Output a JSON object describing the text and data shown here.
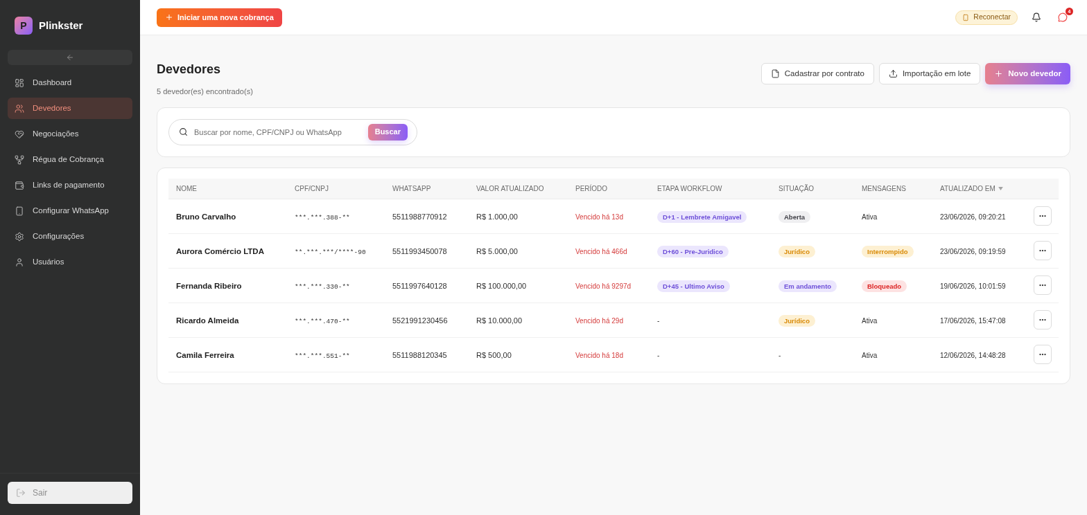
{
  "sidebar": {
    "brand": {
      "initial": "P",
      "name": "Plinkster"
    },
    "items": [
      {
        "label": "Dashboard",
        "selected": false
      },
      {
        "label": "Devedores",
        "selected": true
      },
      {
        "label": "Negociações",
        "selected": false
      },
      {
        "label": "Régua de Cobrança",
        "selected": false
      },
      {
        "label": "Links de pagamento",
        "selected": false
      },
      {
        "label": "Configurar WhatsApp",
        "selected": false
      },
      {
        "label": "Configurações",
        "selected": false
      },
      {
        "label": "Usuários",
        "selected": false
      }
    ],
    "logout": "Sair"
  },
  "topbar": {
    "primary_action": "Iniciar uma nova cobrança",
    "reconnect": "Reconectar",
    "message_count": "4"
  },
  "page": {
    "title": "Devedores",
    "subtitle": "5 devedor(es) encontrado(s)",
    "actions": [
      {
        "label": "Cadastrar por contrato",
        "kind": "outline"
      },
      {
        "label": "Importação em lote",
        "kind": "outline"
      },
      {
        "label": "Novo devedor",
        "kind": "primary"
      }
    ]
  },
  "search": {
    "placeholder": "Buscar por nome, CPF/CNPJ ou WhatsApp",
    "button": "Buscar"
  },
  "table": {
    "columns": [
      {
        "label": "NOME",
        "sorted": false
      },
      {
        "label": "CPF/CNPJ",
        "sorted": false
      },
      {
        "label": "WHATSAPP",
        "sorted": false
      },
      {
        "label": "VALOR ATUALIZADO",
        "sorted": false
      },
      {
        "label": "PERÍODO",
        "sorted": false
      },
      {
        "label": "ETAPA WORKFLOW",
        "sorted": false
      },
      {
        "label": "SITUAÇÃO",
        "sorted": false
      },
      {
        "label": "MENSAGENS",
        "sorted": false
      },
      {
        "label": "ATUALIZADO EM",
        "sorted": true
      }
    ],
    "rows": [
      {
        "nome": "Bruno Carvalho",
        "cpf_cnpj": "***.***.388-**",
        "whatsapp": "5511988770912",
        "valor": "R$ 1.000,00",
        "periodo": "Vencido há 13d",
        "etapa": {
          "text": "D+1 - Lembrete Amigavel",
          "kind": "info"
        },
        "situacao": {
          "text": "Aberta",
          "kind": "neutral"
        },
        "mensagens": {
          "text": "Ativa",
          "kind": "plain"
        },
        "atualizado": "23/06/2026, 09:20:21"
      },
      {
        "nome": "Aurora Comércio LTDA",
        "cpf_cnpj": "**.***.***/****-90",
        "whatsapp": "5511993450078",
        "valor": "R$ 5.000,00",
        "periodo": "Vencido há 466d",
        "etapa": {
          "text": "D+60 - Pre-Juridico",
          "kind": "info"
        },
        "situacao": {
          "text": "Jurídico",
          "kind": "warning"
        },
        "mensagens": {
          "text": "Interrompido",
          "kind": "warning"
        },
        "atualizado": "23/06/2026, 09:19:59"
      },
      {
        "nome": "Fernanda Ribeiro",
        "cpf_cnpj": "***.***.330-**",
        "whatsapp": "5511997640128",
        "valor": "R$ 100.000,00",
        "periodo": "Vencido há 9297d",
        "etapa": {
          "text": "D+45 - Ultimo Aviso",
          "kind": "info"
        },
        "situacao": {
          "text": "Em andamento",
          "kind": "info"
        },
        "mensagens": {
          "text": "Bloqueado",
          "kind": "danger"
        },
        "atualizado": "19/06/2026, 10:01:59"
      },
      {
        "nome": "Ricardo Almeida",
        "cpf_cnpj": "***.***.470-**",
        "whatsapp": "5521991230456",
        "valor": "R$ 10.000,00",
        "periodo": "Vencido há 29d",
        "etapa": {
          "text": "-",
          "kind": "plain"
        },
        "situacao": {
          "text": "Jurídico",
          "kind": "warning"
        },
        "mensagens": {
          "text": "Ativa",
          "kind": "plain"
        },
        "atualizado": "17/06/2026, 15:47:08"
      },
      {
        "nome": "Camila Ferreira",
        "cpf_cnpj": "***.***.551-**",
        "whatsapp": "5511988120345",
        "valor": "R$ 500,00",
        "periodo": "Vencido há 18d",
        "etapa": {
          "text": "-",
          "kind": "plain"
        },
        "situacao": {
          "text": "-",
          "kind": "plain"
        },
        "mensagens": {
          "text": "Ativa",
          "kind": "plain"
        },
        "atualizado": "12/06/2026, 14:48:28"
      }
    ]
  }
}
